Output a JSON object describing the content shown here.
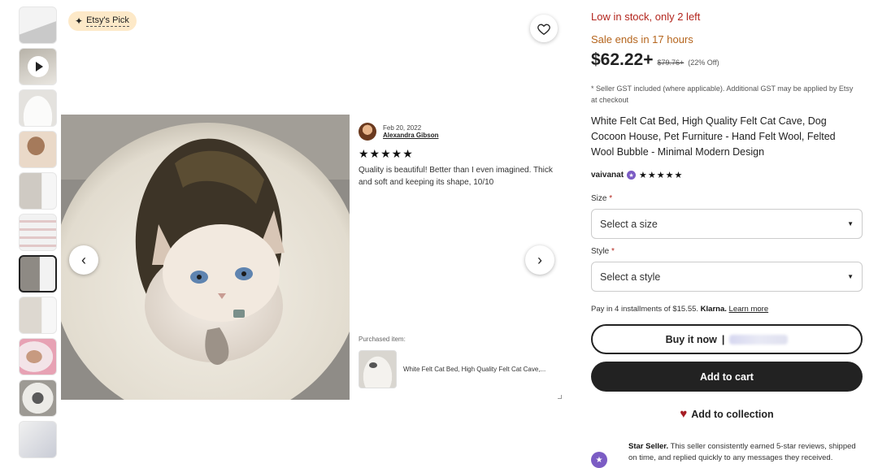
{
  "badge": {
    "label": "Etsy's Pick"
  },
  "gallery": {
    "thumbnail_count": 11,
    "active_index": 6
  },
  "review": {
    "date": "Feb 20, 2022",
    "reviewer": "Alexandra Gibson",
    "stars": "★★★★★",
    "text": "Quality is beautiful! Better than I even imagined. Thick and soft and keeping its shape, 10/10",
    "purchased_label": "Purchased item:",
    "purchased_item": "White Felt Cat Bed, High Quality Felt Cat Cave,..."
  },
  "product": {
    "stock": "Low in stock, only 2 left",
    "sale": "Sale ends in 17 hours",
    "price": "$62.22+",
    "old_price": "$79.76+",
    "discount": "(22% Off)",
    "gst_note": "* Seller GST included (where applicable). Additional GST may be applied by Etsy at checkout",
    "title": "White Felt Cat Bed, High Quality Felt Cat Cave, Dog Cocoon House, Pet Furniture - Hand Felt Wool, Felted Wool Bubble - Minimal Modern Design",
    "seller": "vaivanat",
    "seller_stars": "★★★★★"
  },
  "options": {
    "size_label": "Size",
    "size_placeholder": "Select a size",
    "style_label": "Style",
    "style_placeholder": "Select a style",
    "required_mark": "*"
  },
  "payment": {
    "klarna_text": "Pay in 4 installments of $15.55.",
    "klarna_brand": "Klarna.",
    "learn_more": "Learn more"
  },
  "actions": {
    "buy_now": "Buy it now",
    "buy_now_sep": "|",
    "add_to_cart": "Add to cart",
    "add_to_collection": "Add to collection"
  },
  "star_seller": {
    "title": "Star Seller.",
    "text": "This seller consistently earned 5-star reviews, shipped on time, and replied quickly to any messages they received."
  },
  "colors": {
    "stock": "#b3261e",
    "sale": "#b5651d",
    "badge_bg": "#fde9c8",
    "button_dark": "#222222",
    "star_seller": "#7b5cc4"
  }
}
